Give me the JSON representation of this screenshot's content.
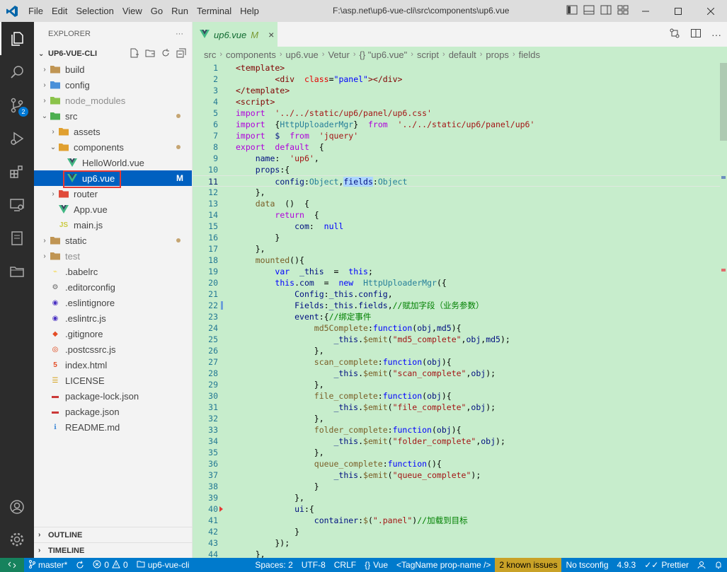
{
  "menu": [
    "File",
    "Edit",
    "Selection",
    "View",
    "Go",
    "Run",
    "Terminal",
    "Help"
  ],
  "window_title": "F:\\asp.net\\up6-vue-cli\\src\\components\\up6.vue",
  "explorer": {
    "header": "EXPLORER",
    "more": "···",
    "project": "UP6-VUE-CLI",
    "tree": [
      {
        "label": "build",
        "depth": 1,
        "type": "folder",
        "open": false
      },
      {
        "label": "config",
        "depth": 1,
        "type": "folder",
        "open": false
      },
      {
        "label": "node_modules",
        "depth": 1,
        "type": "folder",
        "open": false,
        "dim": true
      },
      {
        "label": "src",
        "depth": 1,
        "type": "folder",
        "open": true,
        "dot": true
      },
      {
        "label": "assets",
        "depth": 2,
        "type": "folder",
        "open": false
      },
      {
        "label": "components",
        "depth": 2,
        "type": "folder",
        "open": true,
        "dot": true
      },
      {
        "label": "HelloWorld.vue",
        "depth": 3,
        "type": "vue"
      },
      {
        "label": "up6.vue",
        "depth": 3,
        "type": "vue",
        "selected": true,
        "mark": "M"
      },
      {
        "label": "router",
        "depth": 2,
        "type": "folder",
        "open": false
      },
      {
        "label": "App.vue",
        "depth": 2,
        "type": "vue"
      },
      {
        "label": "main.js",
        "depth": 2,
        "type": "js"
      },
      {
        "label": "static",
        "depth": 1,
        "type": "folder",
        "open": false,
        "dot": true
      },
      {
        "label": "test",
        "depth": 1,
        "type": "folder",
        "open": false,
        "dim": true
      },
      {
        "label": ".babelrc",
        "depth": 1,
        "type": "babel"
      },
      {
        "label": ".editorconfig",
        "depth": 1,
        "type": "editorconfig"
      },
      {
        "label": ".eslintignore",
        "depth": 1,
        "type": "eslint"
      },
      {
        "label": ".eslintrc.js",
        "depth": 1,
        "type": "eslint"
      },
      {
        "label": ".gitignore",
        "depth": 1,
        "type": "git"
      },
      {
        "label": ".postcssrc.js",
        "depth": 1,
        "type": "postcss"
      },
      {
        "label": "index.html",
        "depth": 1,
        "type": "html"
      },
      {
        "label": "LICENSE",
        "depth": 1,
        "type": "license"
      },
      {
        "label": "package-lock.json",
        "depth": 1,
        "type": "npm"
      },
      {
        "label": "package.json",
        "depth": 1,
        "type": "npm"
      },
      {
        "label": "README.md",
        "depth": 1,
        "type": "readme"
      }
    ],
    "outline": "OUTLINE",
    "timeline": "TIMELINE"
  },
  "tab": {
    "label": "up6.vue",
    "modified": "M",
    "close": "×"
  },
  "breadcrumb": [
    "src",
    "components",
    "up6.vue",
    "Vetur",
    "{} \"up6.vue\"",
    "script",
    "default",
    "props",
    "fields"
  ],
  "code_lines": [
    "1",
    "2",
    "3",
    "4",
    "5",
    "6",
    "7",
    "8",
    "9",
    "10",
    "11",
    "12",
    "13",
    "14",
    "15",
    "16",
    "17",
    "18",
    "19",
    "20",
    "21",
    "22",
    "23",
    "24",
    "25",
    "26",
    "27",
    "28",
    "29",
    "30",
    "31",
    "32",
    "33",
    "34",
    "35",
    "36",
    "37",
    "38",
    "39",
    "40",
    "41",
    "42",
    "43",
    "44"
  ],
  "status": {
    "branch": "master*",
    "errors": "0",
    "warnings": "0",
    "project": "up6-vue-cli",
    "spaces": "Spaces: 2",
    "encoding": "UTF-8",
    "eol": "CRLF",
    "language": "Vue",
    "tagname": "<TagName prop-name />",
    "issues": "2 known issues",
    "tsconfig": "No tsconfig",
    "version": "4.9.3",
    "prettier": "Prettier"
  }
}
